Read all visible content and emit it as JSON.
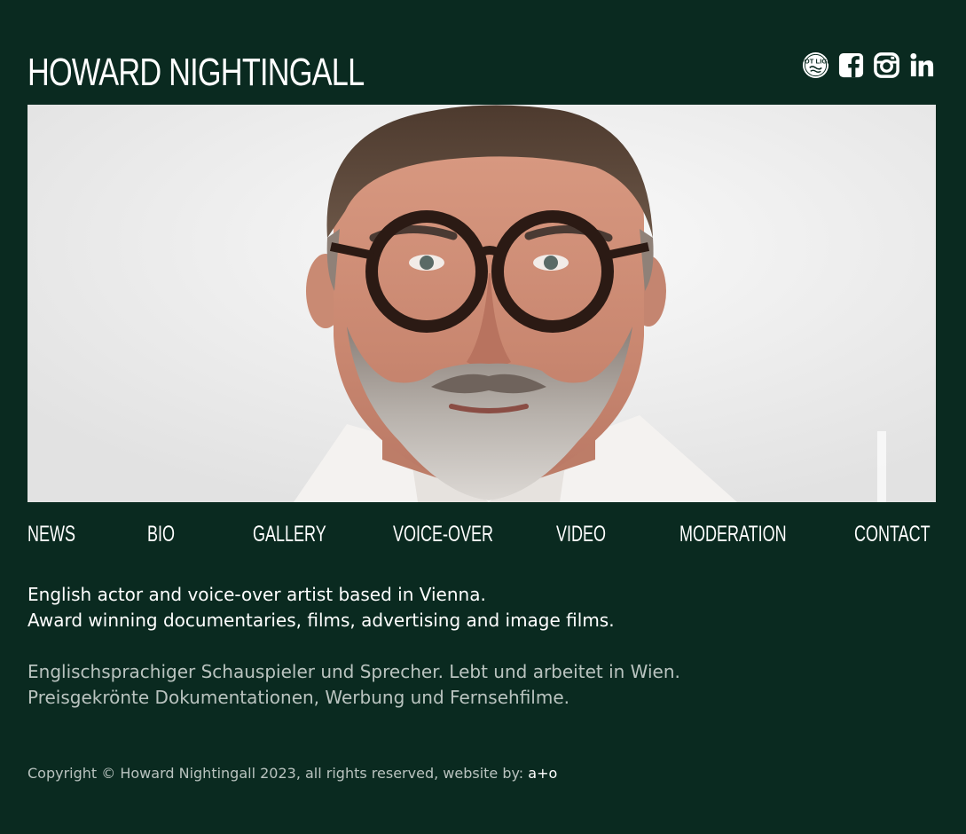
{
  "header": {
    "title": "HOWARD NIGHTINGALL",
    "social": [
      {
        "icon": "spotlight-icon",
        "label": "SPOT LIGHT"
      },
      {
        "icon": "facebook-icon"
      },
      {
        "icon": "instagram-icon"
      },
      {
        "icon": "linkedin-icon"
      }
    ]
  },
  "hero": {
    "image": "portrait of bearded man with round tortoiseshell glasses and white shirt"
  },
  "nav": {
    "items": [
      "NEWS",
      "BIO",
      "GALLERY",
      "VOICE-OVER",
      "VIDEO",
      "MODERATION",
      "CONTACT"
    ]
  },
  "intro": {
    "en_line1": "English actor and voice-over artist based in Vienna.",
    "en_line2": "Award winning documentaries, films, advertising and image films.",
    "de_line1": "Englischsprachiger Schauspieler und Sprecher. Lebt und arbeitet in Wien.",
    "de_line2": "Preisgekrönte Dokumentationen, Werbung und Fernsehfilme."
  },
  "footer": {
    "copyright": "Copyright © Howard Nightingall 2023, all rights reserved, website by: ",
    "credit_link": "a+o"
  },
  "colors": {
    "background": "#0a2a20",
    "text": "#ffffff",
    "muted_text": "#b9c3bf"
  }
}
